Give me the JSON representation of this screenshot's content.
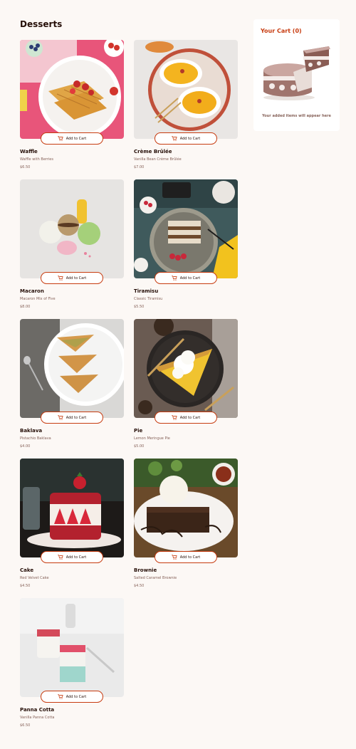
{
  "page": {
    "title": "Desserts"
  },
  "add_to_cart_label": "Add to Cart",
  "products": [
    {
      "name": "Waffle",
      "desc": "Waffle with Berries",
      "price": "$6.50",
      "image": "waffle"
    },
    {
      "name": "Crème Brûlée",
      "desc": "Vanilla Bean Crème Brûlée",
      "price": "$7.00",
      "image": "creme-brulee"
    },
    {
      "name": "Macaron",
      "desc": "Macaron Mix of Five",
      "price": "$8.00",
      "image": "macaron"
    },
    {
      "name": "Tiramisu",
      "desc": "Classic Tiramisu",
      "price": "$5.50",
      "image": "tiramisu"
    },
    {
      "name": "Baklava",
      "desc": "Pistachio Baklava",
      "price": "$4.00",
      "image": "baklava"
    },
    {
      "name": "Pie",
      "desc": "Lemon Meringue Pie",
      "price": "$5.00",
      "image": "pie"
    },
    {
      "name": "Cake",
      "desc": "Red Velvet Cake",
      "price": "$4.50",
      "image": "cake"
    },
    {
      "name": "Brownie",
      "desc": "Salted Caramel Brownie",
      "price": "$4.50",
      "image": "brownie"
    },
    {
      "name": "Panna Cotta",
      "desc": "Vanilla Panna Cotta",
      "price": "$6.50",
      "image": "panna-cotta"
    }
  ],
  "cart": {
    "title": "Your Cart (0)",
    "empty_message": "Your added items will appear here",
    "illustration": "empty-cart-cake-illustration"
  },
  "colors": {
    "background": "#fcf8f5",
    "accent": "#c73b0f",
    "text": "#260f08",
    "muted": "#87635a"
  }
}
